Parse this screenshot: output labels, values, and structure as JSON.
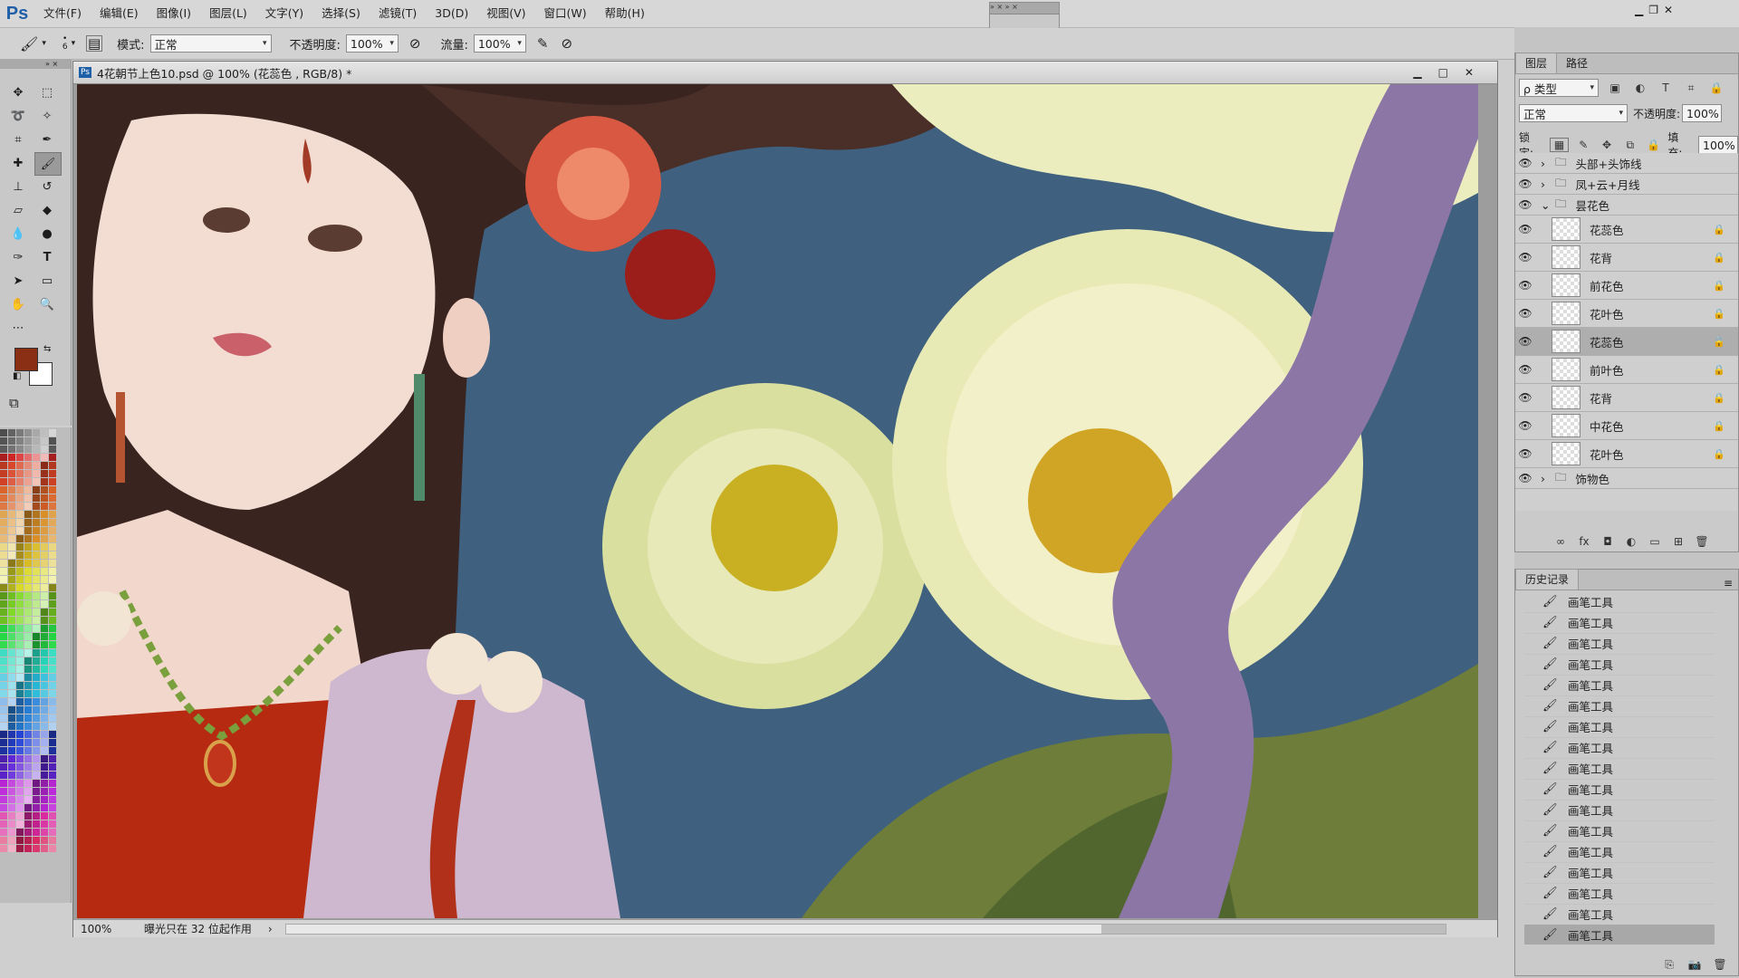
{
  "app": {
    "logo": "Ps"
  },
  "menu": [
    "文件(F)",
    "编辑(E)",
    "图像(I)",
    "图层(L)",
    "文字(Y)",
    "选择(S)",
    "滤镜(T)",
    "3D(D)",
    "视图(V)",
    "窗口(W)",
    "帮助(H)"
  ],
  "options": {
    "brush_size": "6",
    "mode_label": "模式:",
    "mode_value": "正常",
    "opacity_label": "不透明度:",
    "opacity_value": "100%",
    "flow_label": "流量:",
    "flow_value": "100%"
  },
  "colors": {
    "foreground": "#8a2e14",
    "background": "#ffffff",
    "canvas_bg": "#3f607e"
  },
  "document": {
    "title": "4花朝节上色10.psd @ 100% (花蕊色 , RGB/8) *",
    "zoom": "100%",
    "status": "曝光只在 32 位起作用"
  },
  "layers_panel": {
    "tabs": [
      "图层",
      "路径"
    ],
    "filter_label": "ρ 类型",
    "blend_mode": "正常",
    "opacity_label": "不透明度:",
    "opacity_value": "100%",
    "lock_label": "锁定:",
    "fill_label": "填充:",
    "fill_value": "100%",
    "layers": [
      {
        "name": "头部+头饰线",
        "type": "group",
        "collapsed": true
      },
      {
        "name": "凤+云+月线",
        "type": "group",
        "collapsed": true
      },
      {
        "name": "昙花色",
        "type": "group",
        "collapsed": false
      },
      {
        "name": "花蕊色",
        "type": "layer",
        "locked": true
      },
      {
        "name": "花背",
        "type": "layer",
        "locked": true
      },
      {
        "name": "前花色",
        "type": "layer",
        "locked": true
      },
      {
        "name": "花叶色",
        "type": "layer",
        "locked": true
      },
      {
        "name": "花蕊色",
        "type": "layer",
        "locked": true,
        "selected": true
      },
      {
        "name": "前叶色",
        "type": "layer",
        "locked": true
      },
      {
        "name": "花背",
        "type": "layer",
        "locked": true
      },
      {
        "name": "中花色",
        "type": "layer",
        "locked": true
      },
      {
        "name": "花叶色",
        "type": "layer",
        "locked": true
      },
      {
        "name": "饰物色",
        "type": "group",
        "collapsed": true
      }
    ]
  },
  "history_panel": {
    "title": "历史记录",
    "items": [
      "画笔工具",
      "画笔工具",
      "画笔工具",
      "画笔工具",
      "画笔工具",
      "画笔工具",
      "画笔工具",
      "画笔工具",
      "画笔工具",
      "画笔工具",
      "画笔工具",
      "画笔工具",
      "画笔工具",
      "画笔工具",
      "画笔工具",
      "画笔工具",
      "画笔工具"
    ]
  }
}
